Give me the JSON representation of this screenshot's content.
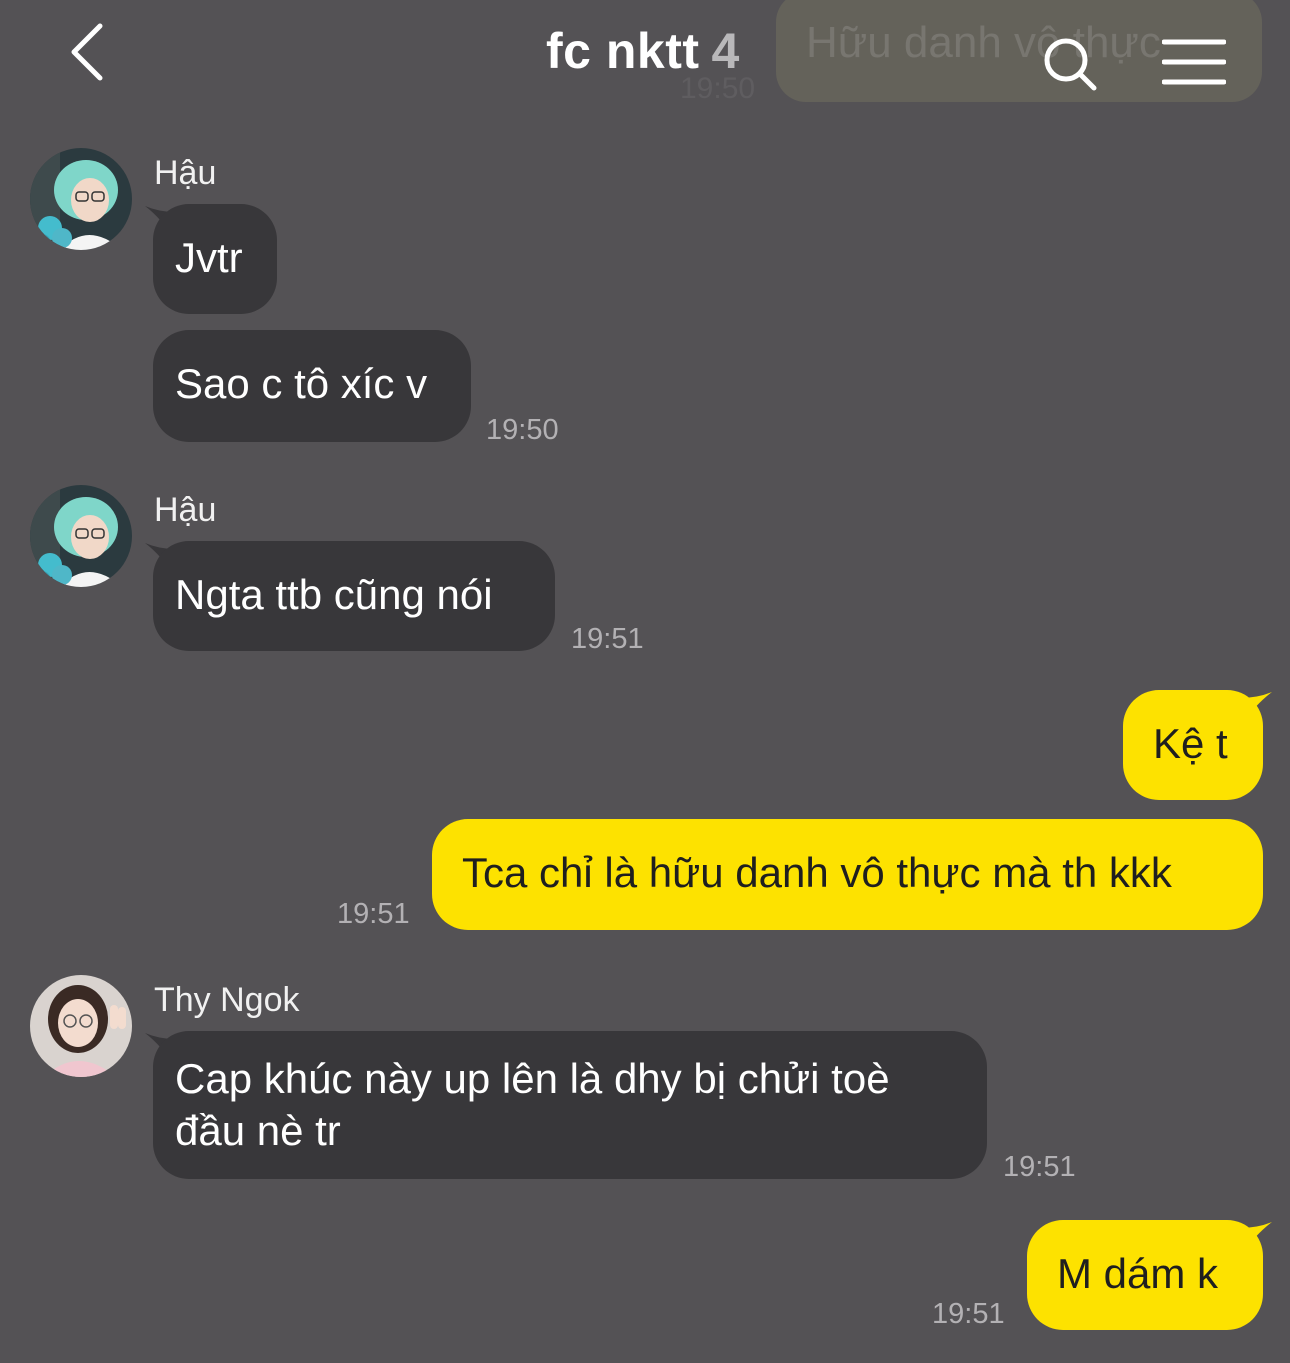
{
  "header": {
    "title": "fc nktt",
    "member_count": "4",
    "back_icon": "chevron-left-icon",
    "search_icon": "search-icon",
    "menu_icon": "menu-icon",
    "ghost_search_text": "Hữu danh vô thực",
    "ghost_time": "19:50"
  },
  "colors": {
    "background": "#545255",
    "incoming_bubble": "#38373a",
    "outgoing_bubble": "#fde200",
    "timestamp": "#b3b1b4"
  },
  "messages": [
    {
      "sender": "Hậu",
      "avatar": "user-avatar-hau",
      "direction": "incoming",
      "text": "Jvtr"
    },
    {
      "sender": "Hậu",
      "direction": "incoming",
      "text": "Sao c tô xíc v",
      "time": "19:50"
    },
    {
      "sender": "Hậu",
      "avatar": "user-avatar-hau",
      "direction": "incoming",
      "text": "Ngta ttb cũng nói",
      "time": "19:51"
    },
    {
      "direction": "outgoing",
      "text": "Kệ t"
    },
    {
      "direction": "outgoing",
      "text": "Tca chỉ là hữu danh vô thực mà th kkk",
      "time": "19:51"
    },
    {
      "sender": "Thy Ngok",
      "avatar": "user-avatar-thy-ngok",
      "direction": "incoming",
      "text": "Cap khúc này up lên là dhy bị chửi toè đầu nè tr",
      "time": "19:51"
    },
    {
      "direction": "outgoing",
      "text": "M dám k",
      "time": "19:51"
    }
  ]
}
